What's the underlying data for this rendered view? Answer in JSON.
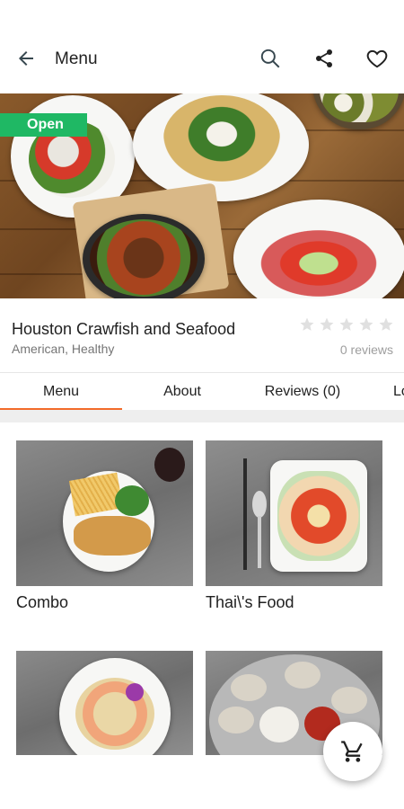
{
  "header": {
    "title": "Menu",
    "back_icon": "arrow-back-icon",
    "actions": [
      "search-icon",
      "share-icon",
      "heart-icon"
    ]
  },
  "hero": {
    "status_badge": "Open",
    "status_color": "#1fb864"
  },
  "restaurant": {
    "name": "Houston Crawfish and Seafood",
    "cuisine": "American, Healthy",
    "rating": 0,
    "max_rating": 5,
    "reviews_label": "0 reviews"
  },
  "tabs": [
    {
      "label": "Menu",
      "active": true
    },
    {
      "label": "About",
      "active": false
    },
    {
      "label": "Reviews (0)",
      "active": false
    },
    {
      "label": "Lo",
      "active": false
    }
  ],
  "accent_color": "#f26b2a",
  "menu_categories": [
    {
      "label": "Combo"
    },
    {
      "label": "Thai\\'s Food"
    },
    {
      "label": ""
    },
    {
      "label": ""
    }
  ],
  "fab": {
    "icon": "cart-icon"
  }
}
